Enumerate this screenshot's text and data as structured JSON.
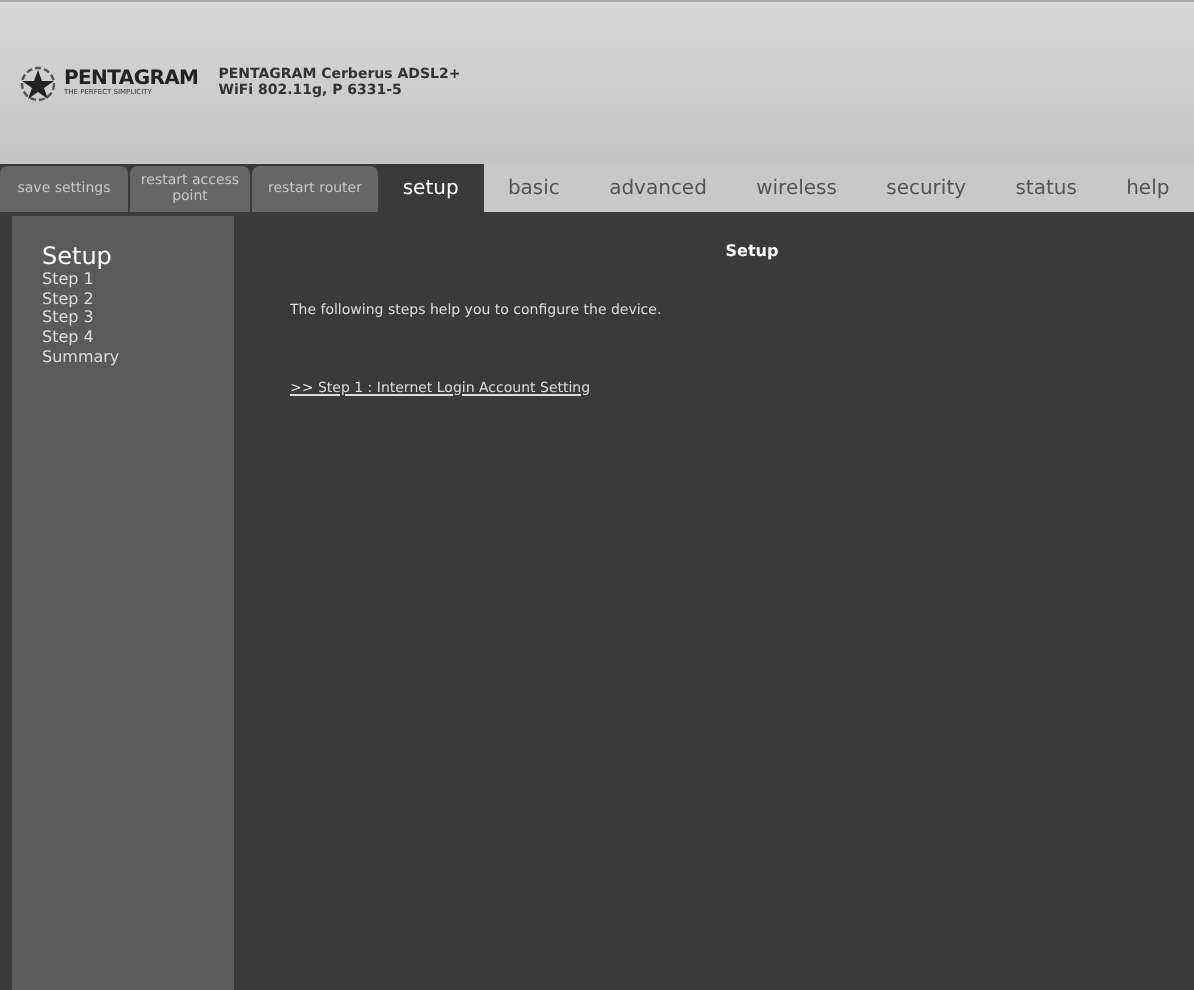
{
  "header": {
    "logo_name": "PENTAGRAM",
    "logo_tagline": "THE PERFECT SIMPLICITY",
    "product_lines": [
      "PENTAGRAM Cerberus ADSL2+",
      "WiFi 802.11g, P 6331-5"
    ]
  },
  "actions": [
    {
      "label": "save settings"
    },
    {
      "label": "restart access point"
    },
    {
      "label": "restart router"
    }
  ],
  "tabs": [
    {
      "label": "setup",
      "selected": true
    },
    {
      "label": "basic",
      "selected": false
    },
    {
      "label": "advanced",
      "selected": false
    },
    {
      "label": "wireless",
      "selected": false
    },
    {
      "label": "security",
      "selected": false
    },
    {
      "label": "status",
      "selected": false
    },
    {
      "label": "help",
      "selected": false
    }
  ],
  "sidebar": {
    "title": "Setup",
    "items": [
      "Step 1",
      "Step 2",
      "Step 3",
      "Step 4",
      "Summary"
    ]
  },
  "content": {
    "title": "Setup",
    "intro": "The following steps help you to configure the device.",
    "link": ">> Step 1 : Internet Login Account Setting"
  }
}
